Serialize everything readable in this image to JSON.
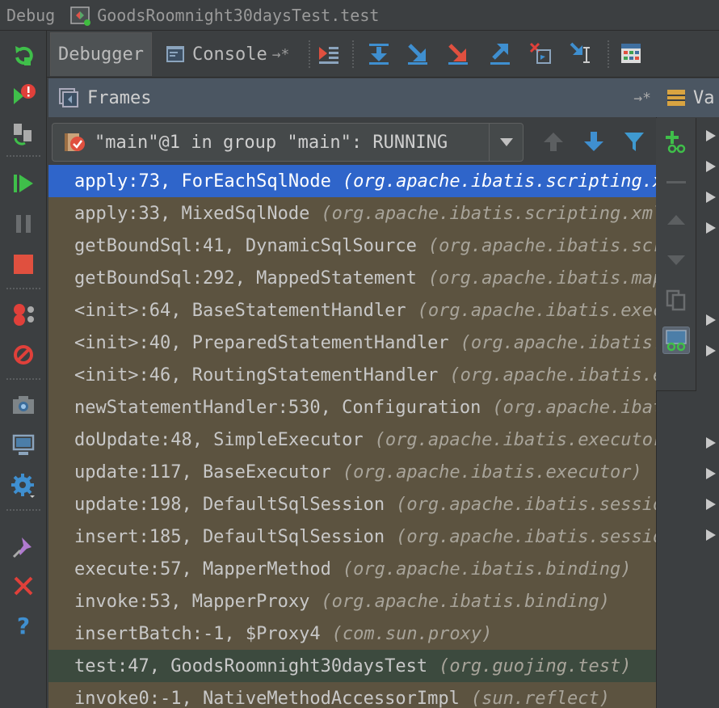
{
  "window": {
    "debug_label": "Debug",
    "config_name": "GoodsRoomnight30daysTest.test"
  },
  "tabs": {
    "debugger": "Debugger",
    "console": "Console",
    "pin": "→*"
  },
  "frames_panel": {
    "title": "Frames",
    "pin": "→*",
    "thread": "\"main\"@1 in group \"main\": RUNNING"
  },
  "variables_panel": {
    "title": "Va"
  },
  "frames": [
    {
      "method": "apply:73, ForEachSqlNode",
      "pkg": "(org.apache.ibatis.scripting.xmltags)",
      "state": "selected"
    },
    {
      "method": "apply:33, MixedSqlNode",
      "pkg": "(org.apache.ibatis.scripting.xmltags)",
      "state": "normal"
    },
    {
      "method": "getBoundSql:41, DynamicSqlSource",
      "pkg": "(org.apache.ibatis.scripting.xmltags)",
      "state": "normal"
    },
    {
      "method": "getBoundSql:292, MappedStatement",
      "pkg": "(org.apache.ibatis.mapping)",
      "state": "normal"
    },
    {
      "method": "<init>:64, BaseStatementHandler",
      "pkg": "(org.apache.ibatis.executor.statement)",
      "state": "normal"
    },
    {
      "method": "<init>:40, PreparedStatementHandler",
      "pkg": "(org.apache.ibatis.executor.statement)",
      "state": "normal"
    },
    {
      "method": "<init>:46, RoutingStatementHandler",
      "pkg": "(org.apache.ibatis.executor.statement)",
      "state": "normal"
    },
    {
      "method": "newStatementHandler:530, Configuration",
      "pkg": "(org.apache.ibatis.session)",
      "state": "normal"
    },
    {
      "method": "doUpdate:48, SimpleExecutor",
      "pkg": "(org.apache.ibatis.executor)",
      "state": "normal"
    },
    {
      "method": "update:117, BaseExecutor",
      "pkg": "(org.apache.ibatis.executor)",
      "state": "normal"
    },
    {
      "method": "update:198, DefaultSqlSession",
      "pkg": "(org.apache.ibatis.session.defaults)",
      "state": "normal"
    },
    {
      "method": "insert:185, DefaultSqlSession",
      "pkg": "(org.apache.ibatis.session.defaults)",
      "state": "normal"
    },
    {
      "method": "execute:57, MapperMethod",
      "pkg": "(org.apache.ibatis.binding)",
      "state": "normal"
    },
    {
      "method": "invoke:53, MapperProxy",
      "pkg": "(org.apache.ibatis.binding)",
      "state": "normal"
    },
    {
      "method": "insertBatch:-1, $Proxy4",
      "pkg": "(com.sun.proxy)",
      "state": "normal"
    },
    {
      "method": "test:47, GoodsRoomnight30daysTest",
      "pkg": "(org.guojing.test)",
      "state": "user"
    },
    {
      "method": "invoke0:-1, NativeMethodAccessorImpl",
      "pkg": "(sun.reflect)",
      "state": "normal"
    }
  ],
  "left_toolbar": [
    "rerun-icon",
    "resume-error-icon",
    "restore-layout-icon",
    "resume-program-icon",
    "pause-icon",
    "stop-icon",
    "view-breakpoints-icon",
    "mute-breakpoints-icon",
    "camera-icon",
    "restore-layout-2-icon",
    "settings-icon",
    "pin-icon",
    "close-icon",
    "help-icon"
  ],
  "colors": {
    "selected_row": "#2f65ca",
    "frames_bg": "#5c5340",
    "user_frame_bg": "#3c4a3e",
    "panel_header": "#4b5662"
  }
}
